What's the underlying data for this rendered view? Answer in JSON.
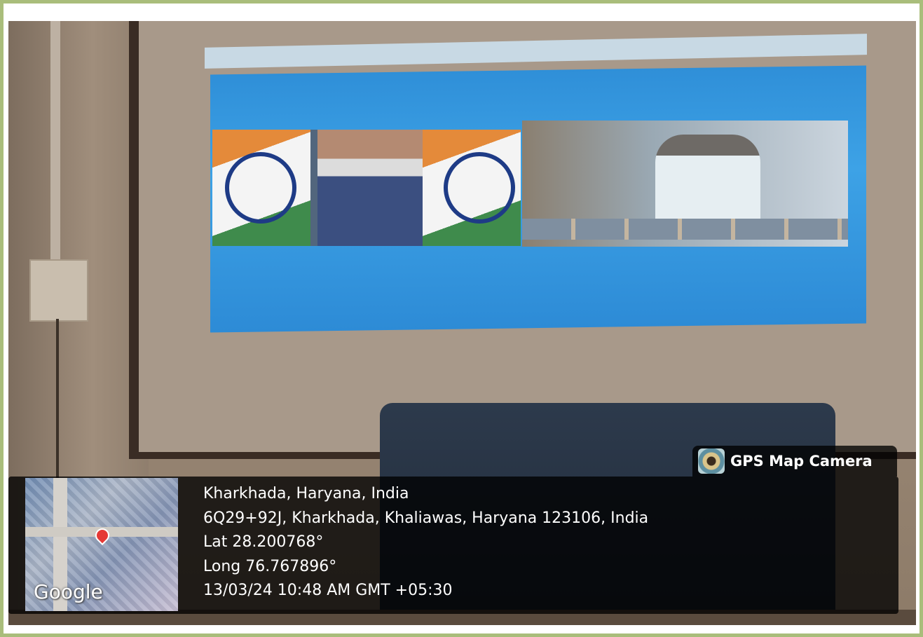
{
  "gps_overlay": {
    "app_name": "GPS Map Camera",
    "place": "Kharkhada, Haryana, India",
    "address": "6Q29+92J, Kharkhada, Khaliawas, Haryana 123106, India",
    "latitude": "Lat 28.200768°",
    "longitude": "Long 76.767896°",
    "datetime": "13/03/24 10:48 AM GMT +05:30",
    "map_label": "Google"
  },
  "colors": {
    "border": "#a9bd7b",
    "projection_blue": "#3da2e6",
    "overlay_bg": "rgba(0,0,0,0.78)",
    "map_pin": "#e53935"
  }
}
